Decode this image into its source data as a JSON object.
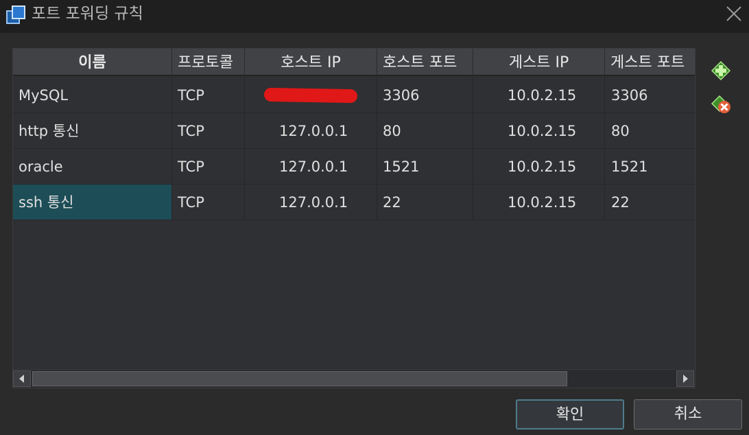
{
  "window": {
    "title": "포트 포워딩 규칙",
    "icon": "window-app-icon",
    "close_icon": "close-icon"
  },
  "table": {
    "columns": [
      "이름",
      "프로토콜",
      "호스트 IP",
      "호스트 포트",
      "게스트 IP",
      "게스트 포트"
    ],
    "rows": [
      {
        "name": "MySQL",
        "protocol": "TCP",
        "host_ip": "",
        "host_port": "3306",
        "guest_ip": "10.0.2.15",
        "guest_port": "3306",
        "host_ip_redacted": true
      },
      {
        "name": "http 통신",
        "protocol": "TCP",
        "host_ip": "127.0.0.1",
        "host_port": "80",
        "guest_ip": "10.0.2.15",
        "guest_port": "80"
      },
      {
        "name": "oracle",
        "protocol": "TCP",
        "host_ip": "127.0.0.1",
        "host_port": "1521",
        "guest_ip": "10.0.2.15",
        "guest_port": "1521"
      },
      {
        "name": "ssh 통신",
        "protocol": "TCP",
        "host_ip": "127.0.0.1",
        "host_port": "22",
        "guest_ip": "10.0.2.15",
        "guest_port": "22",
        "selected": true
      }
    ]
  },
  "side_buttons": {
    "add_icon": "add-rule-icon",
    "remove_icon": "remove-rule-icon"
  },
  "buttons": {
    "ok": "확인",
    "cancel": "취소"
  },
  "colors": {
    "selection": "#1d4d57",
    "redaction": "#e01818",
    "accent_add": "#6cc04a",
    "accent_remove": "#e2603a"
  }
}
